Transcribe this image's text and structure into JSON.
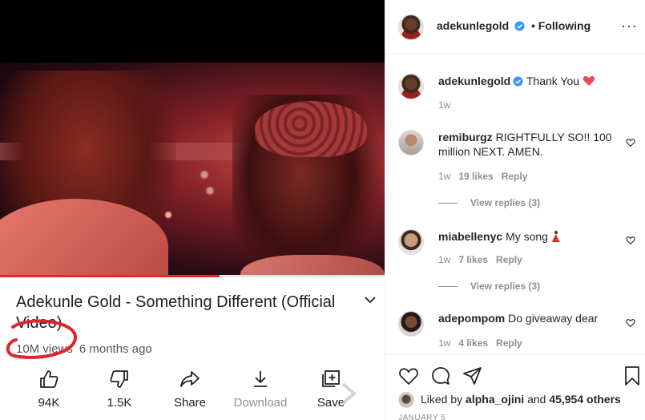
{
  "video": {
    "title": "Adekunle Gold - Something Different (Official Video)",
    "views": "10M views",
    "age": "6 months ago",
    "progress": 0.57,
    "actions": [
      {
        "label": "94K",
        "icon": "thumbs-up-icon"
      },
      {
        "label": "1.5K",
        "icon": "thumbs-down-icon"
      },
      {
        "label": "Share",
        "icon": "share-icon"
      },
      {
        "label": "Download",
        "icon": "download-icon"
      },
      {
        "label": "Save",
        "icon": "save-playlist-icon"
      }
    ]
  },
  "post": {
    "author": "adekunlegold",
    "follow_status": "• Following",
    "caption": "Thank You",
    "caption_time": "1w"
  },
  "comments": [
    {
      "user": "remiburgz",
      "text": "RIGHTFULLY SO!! 100 million NEXT. AMEN.",
      "time": "1w",
      "likes": "19 likes",
      "reply": "Reply",
      "view_replies": "View replies (3)"
    },
    {
      "user": "miabellenyc",
      "text": "My song",
      "time": "1w",
      "likes": "7 likes",
      "reply": "Reply",
      "view_replies": "View replies (3)"
    },
    {
      "user": "adepompom",
      "text": "Do giveaway dear",
      "time": "1w",
      "likes": "4 likes",
      "reply": "Reply"
    }
  ],
  "likes": {
    "prefix": "Liked by",
    "user": "alpha_ojini",
    "middle": "and",
    "count": "45,954 others"
  },
  "date": "JANUARY 5",
  "colors": {
    "youtube_red": "#e52a27",
    "instagram_text": "#262626",
    "muted": "#8e8e8e",
    "verified_blue": "#3897f0",
    "heart_red": "#ed4956"
  }
}
